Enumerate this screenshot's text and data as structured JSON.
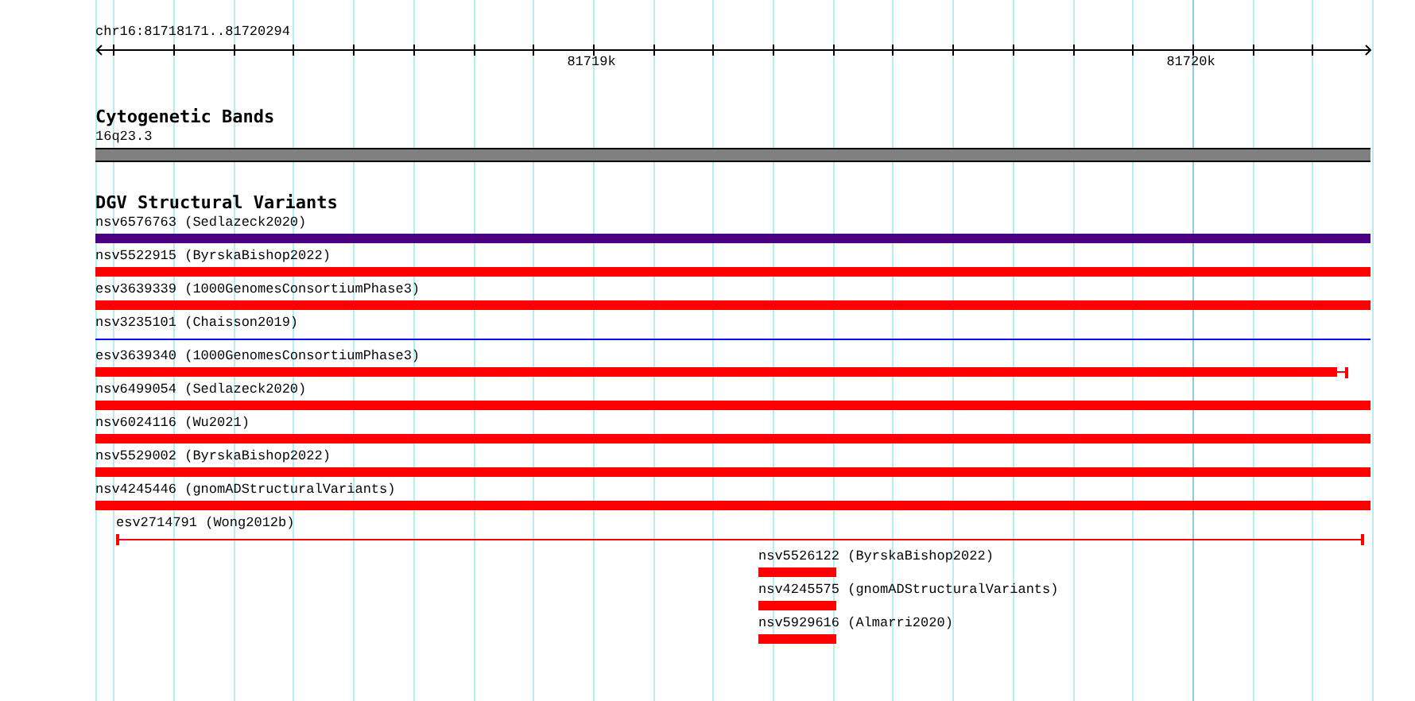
{
  "location": "chr16:81718171..81720294",
  "ruler": {
    "ticks": [
      "81719k",
      "81720k"
    ]
  },
  "tracks": [
    {
      "title": "Cytogenetic Bands",
      "features": [
        {
          "label": "16q23.3",
          "kind": "band",
          "color": "#808080"
        }
      ]
    },
    {
      "title": "DGV Structural Variants",
      "features": [
        {
          "label": "nsv6576763 (Sedlazeck2020)",
          "kind": "full",
          "color": "#4b0082"
        },
        {
          "label": "nsv5522915 (ByrskaBishop2022)",
          "kind": "full",
          "color": "#ff0000"
        },
        {
          "label": "esv3639339 (1000GenomesConsortiumPhase3)",
          "kind": "full",
          "color": "#ff0000"
        },
        {
          "label": "nsv3235101 (Chaisson2019)",
          "kind": "line",
          "color": "#0000ff"
        },
        {
          "label": "esv3639340 (1000GenomesConsortiumPhase3)",
          "kind": "right_cap",
          "color": "#ff0000"
        },
        {
          "label": "nsv6499054 (Sedlazeck2020)",
          "kind": "full",
          "color": "#ff0000"
        },
        {
          "label": "nsv6024116 (Wu2021)",
          "kind": "full",
          "color": "#ff0000"
        },
        {
          "label": "nsv5529002 (ByrskaBishop2022)",
          "kind": "full",
          "color": "#ff0000"
        },
        {
          "label": "nsv4245446 (gnomADStructuralVariants)",
          "kind": "full",
          "color": "#ff0000"
        },
        {
          "label": "esv2714791 (Wong2012b)",
          "kind": "both_caps",
          "color": "#ff0000"
        },
        {
          "label": "nsv5526122 (ByrskaBishop2022)",
          "kind": "short",
          "color": "#ff0000"
        },
        {
          "label": "nsv4245575 (gnomADStructuralVariants)",
          "kind": "short",
          "color": "#ff0000"
        },
        {
          "label": "nsv5929616 (Almarri2020)",
          "kind": "short",
          "color": "#ff0000"
        }
      ]
    }
  ]
}
